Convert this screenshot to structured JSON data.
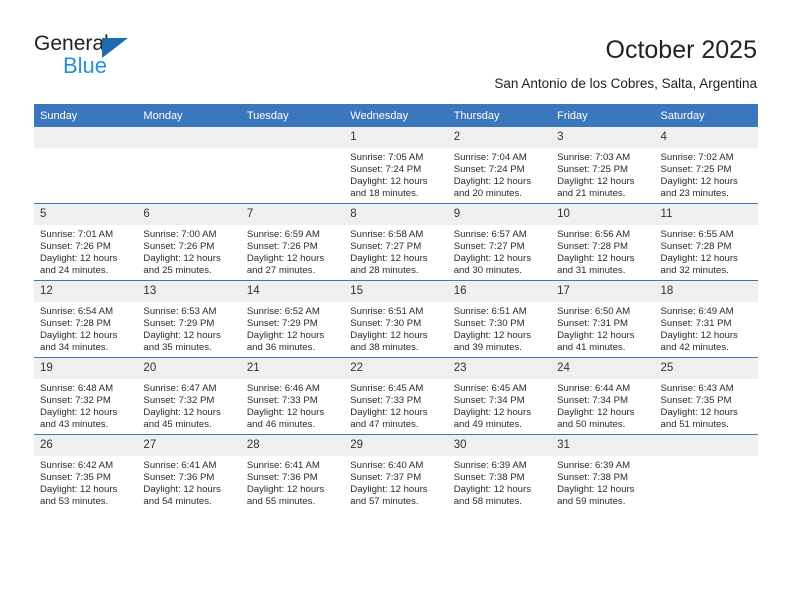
{
  "brand": {
    "name_primary": "General",
    "name_secondary": "Blue",
    "triangle_icon": "triangle-icon",
    "accent_color": "#1E6BB0",
    "secondary_color": "#2A8FD8"
  },
  "header": {
    "title": "October 2025",
    "subtitle": "San Antonio de los Cobres, Salta, Argentina"
  },
  "theme": {
    "header_blue": "#3A77BC",
    "daynum_band": "#EFEFEF",
    "row_divider": "#3A77BC"
  },
  "calendar": {
    "weekday_headers": [
      "Sunday",
      "Monday",
      "Tuesday",
      "Wednesday",
      "Thursday",
      "Friday",
      "Saturday"
    ],
    "weeks": [
      [
        {
          "day": "",
          "empty": true
        },
        {
          "day": "",
          "empty": true
        },
        {
          "day": "",
          "empty": true
        },
        {
          "day": "1",
          "sunrise": "Sunrise: 7:05 AM",
          "sunset": "Sunset: 7:24 PM",
          "daylight_1": "Daylight: 12 hours",
          "daylight_2": "and 18 minutes."
        },
        {
          "day": "2",
          "sunrise": "Sunrise: 7:04 AM",
          "sunset": "Sunset: 7:24 PM",
          "daylight_1": "Daylight: 12 hours",
          "daylight_2": "and 20 minutes."
        },
        {
          "day": "3",
          "sunrise": "Sunrise: 7:03 AM",
          "sunset": "Sunset: 7:25 PM",
          "daylight_1": "Daylight: 12 hours",
          "daylight_2": "and 21 minutes."
        },
        {
          "day": "4",
          "sunrise": "Sunrise: 7:02 AM",
          "sunset": "Sunset: 7:25 PM",
          "daylight_1": "Daylight: 12 hours",
          "daylight_2": "and 23 minutes."
        }
      ],
      [
        {
          "day": "5",
          "sunrise": "Sunrise: 7:01 AM",
          "sunset": "Sunset: 7:26 PM",
          "daylight_1": "Daylight: 12 hours",
          "daylight_2": "and 24 minutes."
        },
        {
          "day": "6",
          "sunrise": "Sunrise: 7:00 AM",
          "sunset": "Sunset: 7:26 PM",
          "daylight_1": "Daylight: 12 hours",
          "daylight_2": "and 25 minutes."
        },
        {
          "day": "7",
          "sunrise": "Sunrise: 6:59 AM",
          "sunset": "Sunset: 7:26 PM",
          "daylight_1": "Daylight: 12 hours",
          "daylight_2": "and 27 minutes."
        },
        {
          "day": "8",
          "sunrise": "Sunrise: 6:58 AM",
          "sunset": "Sunset: 7:27 PM",
          "daylight_1": "Daylight: 12 hours",
          "daylight_2": "and 28 minutes."
        },
        {
          "day": "9",
          "sunrise": "Sunrise: 6:57 AM",
          "sunset": "Sunset: 7:27 PM",
          "daylight_1": "Daylight: 12 hours",
          "daylight_2": "and 30 minutes."
        },
        {
          "day": "10",
          "sunrise": "Sunrise: 6:56 AM",
          "sunset": "Sunset: 7:28 PM",
          "daylight_1": "Daylight: 12 hours",
          "daylight_2": "and 31 minutes."
        },
        {
          "day": "11",
          "sunrise": "Sunrise: 6:55 AM",
          "sunset": "Sunset: 7:28 PM",
          "daylight_1": "Daylight: 12 hours",
          "daylight_2": "and 32 minutes."
        }
      ],
      [
        {
          "day": "12",
          "sunrise": "Sunrise: 6:54 AM",
          "sunset": "Sunset: 7:28 PM",
          "daylight_1": "Daylight: 12 hours",
          "daylight_2": "and 34 minutes."
        },
        {
          "day": "13",
          "sunrise": "Sunrise: 6:53 AM",
          "sunset": "Sunset: 7:29 PM",
          "daylight_1": "Daylight: 12 hours",
          "daylight_2": "and 35 minutes."
        },
        {
          "day": "14",
          "sunrise": "Sunrise: 6:52 AM",
          "sunset": "Sunset: 7:29 PM",
          "daylight_1": "Daylight: 12 hours",
          "daylight_2": "and 36 minutes."
        },
        {
          "day": "15",
          "sunrise": "Sunrise: 6:51 AM",
          "sunset": "Sunset: 7:30 PM",
          "daylight_1": "Daylight: 12 hours",
          "daylight_2": "and 38 minutes."
        },
        {
          "day": "16",
          "sunrise": "Sunrise: 6:51 AM",
          "sunset": "Sunset: 7:30 PM",
          "daylight_1": "Daylight: 12 hours",
          "daylight_2": "and 39 minutes."
        },
        {
          "day": "17",
          "sunrise": "Sunrise: 6:50 AM",
          "sunset": "Sunset: 7:31 PM",
          "daylight_1": "Daylight: 12 hours",
          "daylight_2": "and 41 minutes."
        },
        {
          "day": "18",
          "sunrise": "Sunrise: 6:49 AM",
          "sunset": "Sunset: 7:31 PM",
          "daylight_1": "Daylight: 12 hours",
          "daylight_2": "and 42 minutes."
        }
      ],
      [
        {
          "day": "19",
          "sunrise": "Sunrise: 6:48 AM",
          "sunset": "Sunset: 7:32 PM",
          "daylight_1": "Daylight: 12 hours",
          "daylight_2": "and 43 minutes."
        },
        {
          "day": "20",
          "sunrise": "Sunrise: 6:47 AM",
          "sunset": "Sunset: 7:32 PM",
          "daylight_1": "Daylight: 12 hours",
          "daylight_2": "and 45 minutes."
        },
        {
          "day": "21",
          "sunrise": "Sunrise: 6:46 AM",
          "sunset": "Sunset: 7:33 PM",
          "daylight_1": "Daylight: 12 hours",
          "daylight_2": "and 46 minutes."
        },
        {
          "day": "22",
          "sunrise": "Sunrise: 6:45 AM",
          "sunset": "Sunset: 7:33 PM",
          "daylight_1": "Daylight: 12 hours",
          "daylight_2": "and 47 minutes."
        },
        {
          "day": "23",
          "sunrise": "Sunrise: 6:45 AM",
          "sunset": "Sunset: 7:34 PM",
          "daylight_1": "Daylight: 12 hours",
          "daylight_2": "and 49 minutes."
        },
        {
          "day": "24",
          "sunrise": "Sunrise: 6:44 AM",
          "sunset": "Sunset: 7:34 PM",
          "daylight_1": "Daylight: 12 hours",
          "daylight_2": "and 50 minutes."
        },
        {
          "day": "25",
          "sunrise": "Sunrise: 6:43 AM",
          "sunset": "Sunset: 7:35 PM",
          "daylight_1": "Daylight: 12 hours",
          "daylight_2": "and 51 minutes."
        }
      ],
      [
        {
          "day": "26",
          "sunrise": "Sunrise: 6:42 AM",
          "sunset": "Sunset: 7:35 PM",
          "daylight_1": "Daylight: 12 hours",
          "daylight_2": "and 53 minutes."
        },
        {
          "day": "27",
          "sunrise": "Sunrise: 6:41 AM",
          "sunset": "Sunset: 7:36 PM",
          "daylight_1": "Daylight: 12 hours",
          "daylight_2": "and 54 minutes."
        },
        {
          "day": "28",
          "sunrise": "Sunrise: 6:41 AM",
          "sunset": "Sunset: 7:36 PM",
          "daylight_1": "Daylight: 12 hours",
          "daylight_2": "and 55 minutes."
        },
        {
          "day": "29",
          "sunrise": "Sunrise: 6:40 AM",
          "sunset": "Sunset: 7:37 PM",
          "daylight_1": "Daylight: 12 hours",
          "daylight_2": "and 57 minutes."
        },
        {
          "day": "30",
          "sunrise": "Sunrise: 6:39 AM",
          "sunset": "Sunset: 7:38 PM",
          "daylight_1": "Daylight: 12 hours",
          "daylight_2": "and 58 minutes."
        },
        {
          "day": "31",
          "sunrise": "Sunrise: 6:39 AM",
          "sunset": "Sunset: 7:38 PM",
          "daylight_1": "Daylight: 12 hours",
          "daylight_2": "and 59 minutes."
        },
        {
          "day": "",
          "empty": true
        }
      ]
    ]
  }
}
